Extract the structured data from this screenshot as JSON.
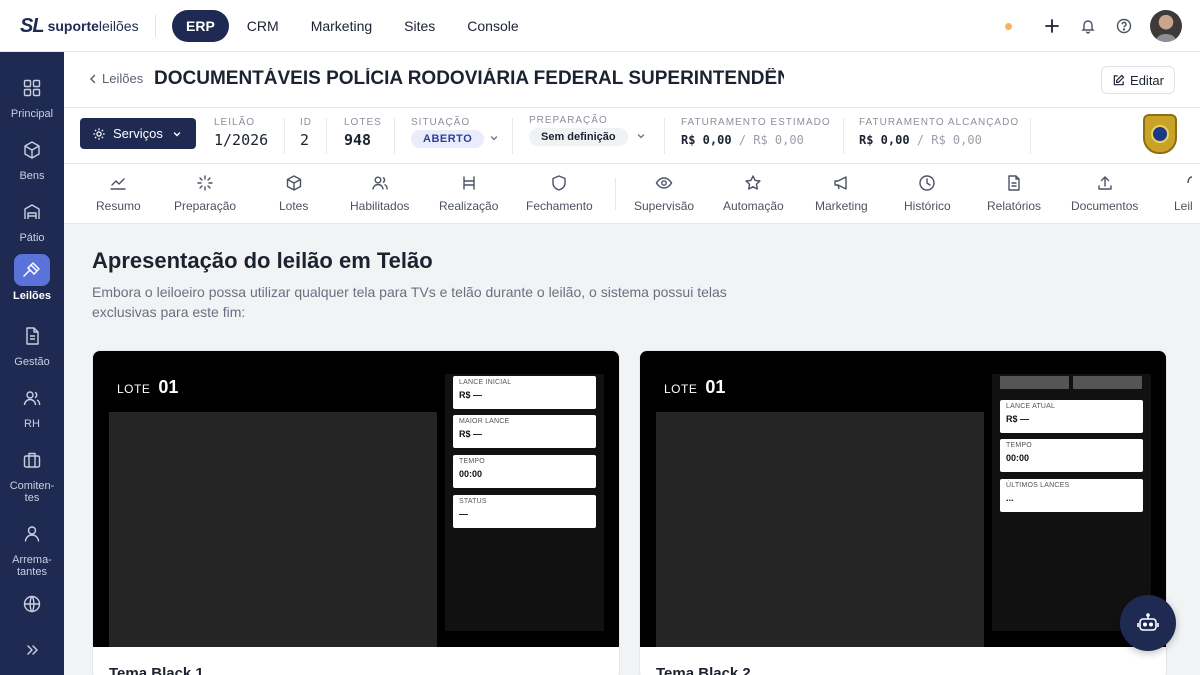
{
  "brand": {
    "mark": "SL",
    "name_bold": "suporte",
    "name_light": "leilões"
  },
  "topnav": [
    {
      "label": "ERP",
      "active": true
    },
    {
      "label": "CRM"
    },
    {
      "label": "Marketing"
    },
    {
      "label": "Sites"
    },
    {
      "label": "Console"
    }
  ],
  "sidebar": [
    {
      "label": "Principal",
      "icon": "grid-icon"
    },
    {
      "label": "Bens",
      "icon": "box-icon"
    },
    {
      "label": "Pátio",
      "icon": "warehouse-icon"
    },
    {
      "label": "Leilões",
      "icon": "gavel-icon",
      "active": true
    },
    {
      "label": "Gestão",
      "icon": "document-icon"
    },
    {
      "label": "RH",
      "icon": "users-icon"
    },
    {
      "label": "Comiten-\ntes",
      "icon": "briefcase-icon"
    },
    {
      "label": "Arrema-\ntantes",
      "icon": "user-icon"
    },
    {
      "label": "",
      "icon": "globe-icon"
    },
    {
      "label": "",
      "icon": "chevrons-right-icon"
    }
  ],
  "header": {
    "back_label": "Leilões",
    "title": "DOCUMENTÁVEIS POLÍCIA RODOVIÁRIA FEDERAL SUPERINTENDÊNCI...",
    "edit_label": "Editar"
  },
  "info": {
    "services_label": "Serviços",
    "leilao_key": "LEILÃO",
    "leilao_value": "1/2026",
    "id_key": "ID",
    "id_value": "2",
    "lotes_key": "LOTES",
    "lotes_value": "948",
    "situacao_key": "SITUAÇÃO",
    "situacao_value": "ABERTO",
    "preparacao_key": "PREPARAÇÃO",
    "preparacao_value": "Sem definição",
    "fat_estimado_key": "FATURAMENTO ESTIMADO",
    "fat_estimado_value": "R$ 0,00",
    "fat_estimado_sub": "/ R$ 0,00",
    "fat_alcancado_key": "FATURAMENTO ALCANÇADO",
    "fat_alcancado_value": "R$ 0,00",
    "fat_alcancado_sub": "/ R$ 0,00"
  },
  "tabs": [
    {
      "label": "Resumo",
      "icon": "chart-line-icon"
    },
    {
      "label": "Preparação",
      "icon": "loader-icon"
    },
    {
      "label": "Lotes",
      "icon": "box-icon"
    },
    {
      "label": "Habilitados",
      "icon": "users-icon"
    },
    {
      "label": "Realização",
      "icon": "gavel-icon"
    },
    {
      "label": "Fechamento",
      "icon": "shield-icon"
    },
    {
      "label": "Supervisão",
      "icon": "eye-icon"
    },
    {
      "label": "Automação",
      "icon": "star-icon"
    },
    {
      "label": "Marketing",
      "icon": "megaphone-icon"
    },
    {
      "label": "Histórico",
      "icon": "clock-icon"
    },
    {
      "label": "Relatórios",
      "icon": "file-text-icon"
    },
    {
      "label": "Documentos",
      "icon": "upload-icon"
    },
    {
      "label": "Leil",
      "icon": "partial-icon"
    }
  ],
  "content": {
    "title": "Apresentação do leilão em Telão",
    "description": "Embora o leiloeiro possa utilizar qualquer tela para TVs e telão durante o leilão, o sistema possui telas exclusivas para este fim:"
  },
  "themes": [
    {
      "name": "Tema Black 1",
      "lot_word": "LOTE",
      "lot_number": "01",
      "boxes": [
        {
          "title": "LANCE INICIAL",
          "value": "R$ —"
        },
        {
          "title": "MAIOR LANCE",
          "value": "R$ —"
        },
        {
          "title": "TEMPO",
          "value": "00:00"
        },
        {
          "title": "STATUS",
          "value": "—"
        }
      ]
    },
    {
      "name": "Tema Black 2",
      "lot_word": "LOTE",
      "lot_number": "01",
      "boxes": [
        {
          "title": "LANCE ATUAL",
          "value": "R$ —"
        },
        {
          "title": "TEMPO",
          "value": "00:00"
        },
        {
          "title": "ÚLTIMOS LANCES",
          "value": "..."
        }
      ]
    }
  ],
  "colors": {
    "navy": "#1f2a52",
    "accent": "#5a73d8",
    "status_dot": "#f5b45a"
  }
}
